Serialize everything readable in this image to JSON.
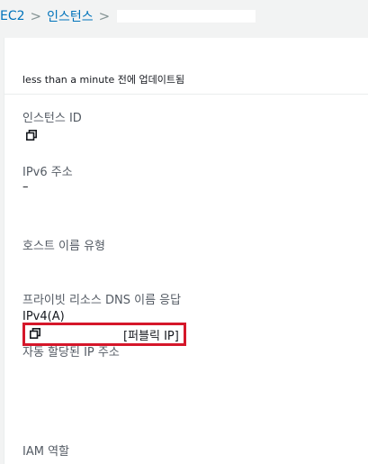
{
  "breadcrumb": {
    "items": [
      "EC2",
      "인스턴스"
    ],
    "separator": ">"
  },
  "header": {
    "updated_text": "less than a minute 전에 업데이트됨"
  },
  "fields": {
    "instance_id": {
      "label": "인스턴스 ID"
    },
    "ipv6": {
      "label": "IPv6 주소",
      "value": "–"
    },
    "hostname_type": {
      "label": "호스트 이름 유형"
    },
    "private_dns": {
      "label": "프라이빗 리소스 DNS 이름 응답",
      "value": "IPv4(A)"
    },
    "auto_ip": {
      "label": "자동 할당된 IP 주소",
      "tag": "[퍼블릭 IP]"
    },
    "iam_role": {
      "label": "IAM 역할"
    }
  },
  "colors": {
    "link": "#0073bb",
    "highlight": "#d5172a"
  },
  "icons": {
    "copy": "copy-icon"
  }
}
